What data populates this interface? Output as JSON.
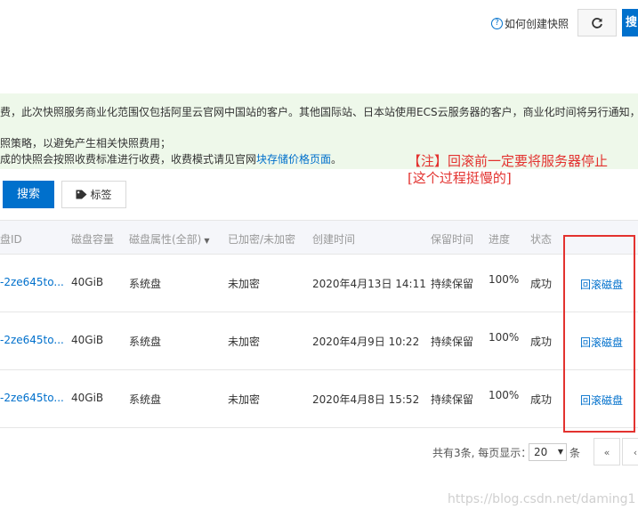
{
  "header": {
    "help_icon_text": "?",
    "help_link": "如何创建快照",
    "create_label": "搜"
  },
  "notice": {
    "line1": "费，此次快照服务商业化范围仅包括阿里云官网中国站的客户。其他国际站、日本站使用ECS云服务器的客户，商业化时间将另行通知，具",
    "line2": "照策略，以避免产生相关快照费用；",
    "line3_prefix": "成的快照会按照收费标准进行收费，收费模式请见官网",
    "line3_link": "块存储价格页面",
    "line3_suffix": "。"
  },
  "annotation": {
    "line1": "【注】回滚前一定要将服务器停止",
    "line2": "[这个过程挺慢的]"
  },
  "toolbar": {
    "search_label": "搜索",
    "tag_label": "标签"
  },
  "table": {
    "headers": {
      "disk_id": "盘ID",
      "size": "磁盘容量",
      "attr": "磁盘属性(全部)",
      "encrypt": "已加密/未加密",
      "created": "创建时间",
      "retention": "保留时间",
      "progress": "进度",
      "status": "状态"
    },
    "rows": [
      {
        "disk_id": "-2ze645to...",
        "size": "40GiB",
        "attr": "系统盘",
        "encrypt": "未加密",
        "created": "2020年4月13日 14:11",
        "retention": "持续保留",
        "progress": "100%",
        "status": "成功",
        "action": "回滚磁盘"
      },
      {
        "disk_id": "-2ze645to...",
        "size": "40GiB",
        "attr": "系统盘",
        "encrypt": "未加密",
        "created": "2020年4月9日 10:22",
        "retention": "持续保留",
        "progress": "100%",
        "status": "成功",
        "action": "回滚磁盘"
      },
      {
        "disk_id": "-2ze645to...",
        "size": "40GiB",
        "attr": "系统盘",
        "encrypt": "未加密",
        "created": "2020年4月8日 15:52",
        "retention": "持续保留",
        "progress": "100%",
        "status": "成功",
        "action": "回滚磁盘"
      }
    ]
  },
  "pager": {
    "summary": "共有3条, 每页显示：",
    "page_size": "20",
    "unit": "条",
    "prev_label": "«",
    "prev2_label": "‹"
  },
  "watermark": "https://blog.csdn.net/daming1",
  "colors": {
    "accent": "#0070cc",
    "annotation_red": "#e3322f",
    "notice_bg": "#eef8ea"
  }
}
